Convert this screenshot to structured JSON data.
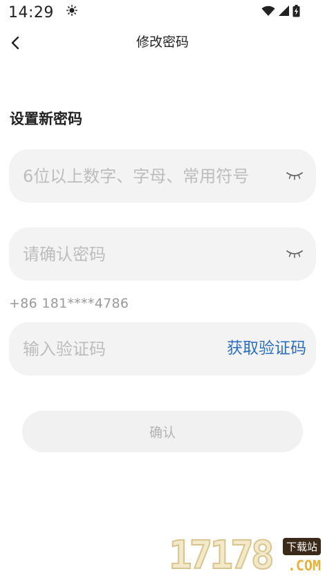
{
  "status_bar": {
    "time": "14:29",
    "weather_icon": "sun-icon",
    "wifi_icon": "wifi-icon",
    "signal_icon": "signal-icon",
    "battery_icon": "battery-charging-icon"
  },
  "nav": {
    "back_icon": "chevron-left-icon",
    "title": "修改密码"
  },
  "form": {
    "section_title": "设置新密码",
    "new_password": {
      "placeholder": "6位以上数字、字母、常用符号",
      "value": "",
      "toggle_icon": "eye-closed-icon"
    },
    "confirm_password": {
      "placeholder": "请确认密码",
      "value": "",
      "toggle_icon": "eye-closed-icon"
    },
    "phone": "+86 181****4786",
    "verification_code": {
      "placeholder": "输入验证码",
      "value": "",
      "get_code_label": "获取验证码"
    },
    "confirm_label": "确认"
  },
  "watermark": {
    "digits": "17178",
    "badge": "下载站",
    "domain": ".COM"
  },
  "colors": {
    "accent": "#2f6fbf",
    "field_bg": "#f3f3f3",
    "placeholder": "#bdbdbd",
    "disabled_text": "#b3b3b3"
  }
}
